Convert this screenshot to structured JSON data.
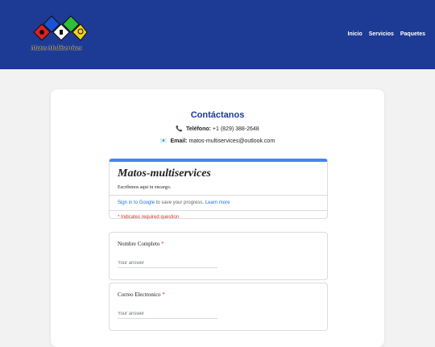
{
  "header": {
    "logo_text": "Matos Multiservices",
    "nav": [
      "Inicio",
      "Servicios",
      "Paquetes"
    ],
    "colors": {
      "background": "#1d3a94"
    }
  },
  "contact": {
    "title": "Contáctanos",
    "phone_label": "Teléfono:",
    "phone_value": "+1 (829) 388-2648",
    "email_label": "Email:",
    "email_value": "matos-multiservices@outlook.com",
    "phone_icon": "phone-icon",
    "email_icon": "envelope-icon"
  },
  "form": {
    "title": "Matos-multiservices",
    "description": "Escribenos aqui tu encargo.",
    "sign_in_link": "Sign in to Google",
    "sign_in_text": "to save your progress.",
    "learn_more": "Learn more",
    "required_note": "* Indicates required question",
    "questions": [
      {
        "label": "Nombre Completo",
        "placeholder": "Your answer"
      },
      {
        "label": "Correo Electronico",
        "placeholder": "Your answer"
      }
    ]
  }
}
